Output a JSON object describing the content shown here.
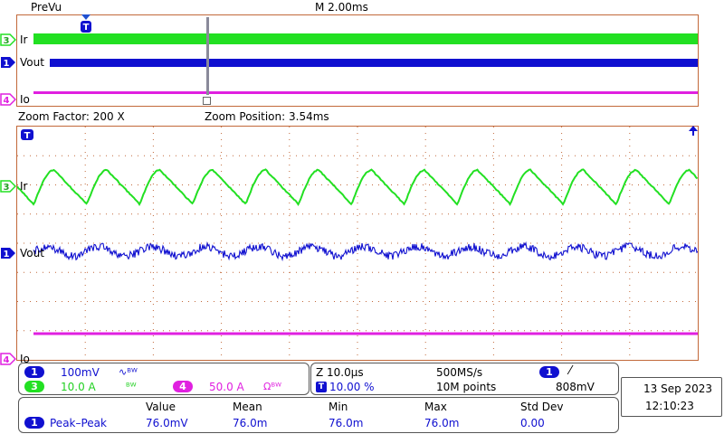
{
  "header": {
    "mode": "PreVu",
    "timebase": "M 2.00ms"
  },
  "zoom_info": {
    "factor": "Zoom Factor: 200 X",
    "position": "Zoom Position: 3.54ms"
  },
  "channels": {
    "ch3": {
      "num": "3",
      "label": "Ir",
      "color": "#22e022"
    },
    "ch1": {
      "num": "1",
      "label": "Vout",
      "color": "#1010d0"
    },
    "ch4": {
      "num": "4",
      "label": "Io",
      "color": "#e020e0"
    }
  },
  "trigger_marker": "T",
  "vertical_panel": {
    "ch1_scale": "100mV",
    "ch1_coupling": "∿ᴮᵂ",
    "ch3_scale": "10.0 A",
    "ch3_coupling": "ᴮᵂ",
    "ch4_scale": "50.0 A",
    "ch4_coupling": "Ωᴮᵂ"
  },
  "horizontal_panel": {
    "zoom_scale": "Z 10.0µs",
    "sample_rate": "500MS/s",
    "trigger_pos": "10.00 %",
    "record_length": "10M points",
    "trigger_level": "808mV",
    "trigger_slope": "⁄"
  },
  "datetime": {
    "date": "13 Sep  2023",
    "time": "12:10:23"
  },
  "measurements": {
    "headers": [
      "Value",
      "Mean",
      "Min",
      "Max",
      "Std Dev"
    ],
    "row": {
      "channel": "1",
      "name": "Peak–Peak",
      "values": [
        "76.0mV",
        "76.0m",
        "76.0m",
        "76.0m",
        "0.00"
      ]
    }
  },
  "colors": {
    "grid": "#c2693a",
    "background": "#ffffff",
    "panel_pill_blue": "#1010d0"
  }
}
